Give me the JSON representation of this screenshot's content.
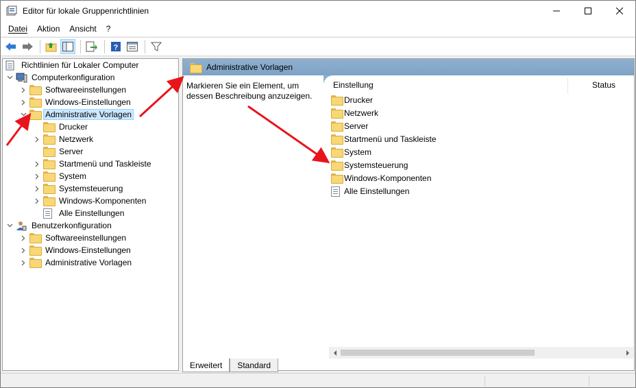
{
  "window": {
    "title": "Editor für lokale Gruppenrichtlinien",
    "minimize": "—",
    "maximize": "☐",
    "close": "✕"
  },
  "menu": [
    {
      "label": "Datei"
    },
    {
      "label": "Aktion"
    },
    {
      "label": "Ansicht"
    },
    {
      "label": "?"
    }
  ],
  "toolbar": {
    "icons": [
      "back-icon",
      "forward-icon",
      "up-folder-icon",
      "show-hide-tree-icon",
      "export-list-icon",
      "help-icon",
      "properties-icon",
      "filter-icon"
    ]
  },
  "tree": {
    "root": "Richtlinien für Lokaler Computer",
    "computer": "Computerkonfiguration",
    "c_software": "Softwareeinstellungen",
    "c_windows": "Windows-Einstellungen",
    "c_admin": "Administrative Vorlagen",
    "c_admin_children": [
      "Drucker",
      "Netzwerk",
      "Server",
      "Startmenü und Taskleiste",
      "System",
      "Systemsteuerung",
      "Windows-Komponenten",
      "Alle Einstellungen"
    ],
    "user": "Benutzerkonfiguration",
    "u_software": "Softwareeinstellungen",
    "u_windows": "Windows-Einstellungen",
    "u_admin": "Administrative Vorlagen"
  },
  "right": {
    "header_title": "Administrative Vorlagen",
    "description": "Markieren Sie ein Element, um dessen Beschreibung anzuzeigen.",
    "col_setting": "Einstellung",
    "col_status": "Status",
    "items": [
      "Drucker",
      "Netzwerk",
      "Server",
      "Startmenü und Taskleiste",
      "System",
      "Systemsteuerung",
      "Windows-Komponenten",
      "Alle Einstellungen"
    ]
  },
  "tabs": {
    "extended": "Erweitert",
    "standard": "Standard"
  },
  "colors": {
    "annotation_arrow": "#e8141c",
    "selection_bg": "#cce8ff",
    "header_bg": "#8fb0cf"
  }
}
